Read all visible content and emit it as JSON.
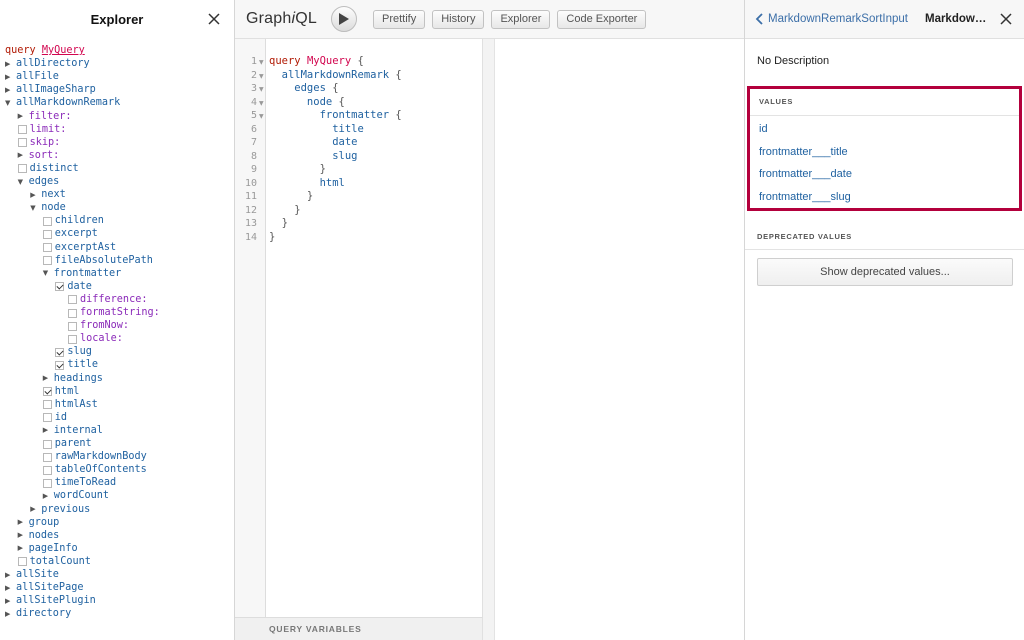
{
  "explorer": {
    "title": "Explorer",
    "tree": [
      {
        "d": 0,
        "t": "none",
        "label": "query",
        "label2": "MyQuery",
        "c": "kw"
      },
      {
        "d": 0,
        "t": "right",
        "label": "allDirectory",
        "c": "field"
      },
      {
        "d": 0,
        "t": "right",
        "label": "allFile",
        "c": "field"
      },
      {
        "d": 0,
        "t": "right",
        "label": "allImageSharp",
        "c": "field"
      },
      {
        "d": 0,
        "t": "down",
        "label": "allMarkdownRemark",
        "c": "field"
      },
      {
        "d": 1,
        "t": "right",
        "label": "filter:",
        "c": "arg"
      },
      {
        "d": 1,
        "t": "cb",
        "label": "limit:",
        "c": "arg"
      },
      {
        "d": 1,
        "t": "cb",
        "label": "skip:",
        "c": "arg"
      },
      {
        "d": 1,
        "t": "right",
        "label": "sort:",
        "c": "arg"
      },
      {
        "d": 1,
        "t": "cb",
        "label": "distinct",
        "c": "field"
      },
      {
        "d": 1,
        "t": "down",
        "label": "edges",
        "c": "field"
      },
      {
        "d": 2,
        "t": "right",
        "label": "next",
        "c": "field"
      },
      {
        "d": 2,
        "t": "down",
        "label": "node",
        "c": "field"
      },
      {
        "d": 3,
        "t": "cb",
        "label": "children",
        "c": "field"
      },
      {
        "d": 3,
        "t": "cb",
        "label": "excerpt",
        "c": "field"
      },
      {
        "d": 3,
        "t": "cb",
        "label": "excerptAst",
        "c": "field"
      },
      {
        "d": 3,
        "t": "cb",
        "label": "fileAbsolutePath",
        "c": "field"
      },
      {
        "d": 3,
        "t": "down",
        "label": "frontmatter",
        "c": "field"
      },
      {
        "d": 4,
        "t": "cbc",
        "label": "date",
        "c": "field"
      },
      {
        "d": 5,
        "t": "cb",
        "label": "difference:",
        "c": "arg"
      },
      {
        "d": 5,
        "t": "cb",
        "label": "formatString:",
        "c": "arg"
      },
      {
        "d": 5,
        "t": "cb",
        "label": "fromNow:",
        "c": "arg"
      },
      {
        "d": 5,
        "t": "cb",
        "label": "locale:",
        "c": "arg"
      },
      {
        "d": 4,
        "t": "cbc",
        "label": "slug",
        "c": "field"
      },
      {
        "d": 4,
        "t": "cbc",
        "label": "title",
        "c": "field"
      },
      {
        "d": 3,
        "t": "right",
        "label": "headings",
        "c": "field"
      },
      {
        "d": 3,
        "t": "cbc",
        "label": "html",
        "c": "field"
      },
      {
        "d": 3,
        "t": "cb",
        "label": "htmlAst",
        "c": "field"
      },
      {
        "d": 3,
        "t": "cb",
        "label": "id",
        "c": "field"
      },
      {
        "d": 3,
        "t": "right",
        "label": "internal",
        "c": "field"
      },
      {
        "d": 3,
        "t": "cb",
        "label": "parent",
        "c": "field"
      },
      {
        "d": 3,
        "t": "cb",
        "label": "rawMarkdownBody",
        "c": "field"
      },
      {
        "d": 3,
        "t": "cb",
        "label": "tableOfContents",
        "c": "field"
      },
      {
        "d": 3,
        "t": "cb",
        "label": "timeToRead",
        "c": "field"
      },
      {
        "d": 3,
        "t": "right",
        "label": "wordCount",
        "c": "field"
      },
      {
        "d": 2,
        "t": "right",
        "label": "previous",
        "c": "field"
      },
      {
        "d": 1,
        "t": "right",
        "label": "group",
        "c": "field"
      },
      {
        "d": 1,
        "t": "right",
        "label": "nodes",
        "c": "field"
      },
      {
        "d": 1,
        "t": "right",
        "label": "pageInfo",
        "c": "field"
      },
      {
        "d": 1,
        "t": "cb",
        "label": "totalCount",
        "c": "field"
      },
      {
        "d": 0,
        "t": "right",
        "label": "allSite",
        "c": "field"
      },
      {
        "d": 0,
        "t": "right",
        "label": "allSitePage",
        "c": "field"
      },
      {
        "d": 0,
        "t": "right",
        "label": "allSitePlugin",
        "c": "field"
      },
      {
        "d": 0,
        "t": "right",
        "label": "directory",
        "c": "field"
      }
    ]
  },
  "toolbar": {
    "logo_prefix": "Graph",
    "logo_i": "i",
    "logo_suffix": "QL",
    "prettify": "Prettify",
    "history": "History",
    "explorer": "Explorer",
    "code_exporter": "Code Exporter"
  },
  "editor": {
    "lines": [
      {
        "n": "1",
        "fold": true,
        "parts": [
          {
            "t": "query ",
            "c": "#b11a04"
          },
          {
            "t": "MyQuery",
            "c": "#d2054e"
          },
          {
            "t": " {",
            "c": "#555"
          }
        ]
      },
      {
        "n": "2",
        "fold": true,
        "parts": [
          {
            "t": "  allMarkdownRemark",
            "c": "#1f61a0"
          },
          {
            "t": " {",
            "c": "#555"
          }
        ]
      },
      {
        "n": "3",
        "fold": true,
        "parts": [
          {
            "t": "    edges",
            "c": "#1f61a0"
          },
          {
            "t": " {",
            "c": "#555"
          }
        ]
      },
      {
        "n": "4",
        "fold": true,
        "parts": [
          {
            "t": "      node",
            "c": "#1f61a0"
          },
          {
            "t": " {",
            "c": "#555"
          }
        ]
      },
      {
        "n": "5",
        "fold": true,
        "parts": [
          {
            "t": "        frontmatter",
            "c": "#1f61a0"
          },
          {
            "t": " {",
            "c": "#555"
          }
        ]
      },
      {
        "n": "6",
        "fold": false,
        "parts": [
          {
            "t": "          title",
            "c": "#1f61a0"
          }
        ]
      },
      {
        "n": "7",
        "fold": false,
        "parts": [
          {
            "t": "          date",
            "c": "#1f61a0"
          }
        ]
      },
      {
        "n": "8",
        "fold": false,
        "parts": [
          {
            "t": "          slug",
            "c": "#1f61a0"
          }
        ]
      },
      {
        "n": "9",
        "fold": false,
        "parts": [
          {
            "t": "        }",
            "c": "#555"
          }
        ]
      },
      {
        "n": "10",
        "fold": false,
        "parts": [
          {
            "t": "        html",
            "c": "#1f61a0"
          }
        ]
      },
      {
        "n": "11",
        "fold": false,
        "parts": [
          {
            "t": "      }",
            "c": "#555"
          }
        ]
      },
      {
        "n": "12",
        "fold": false,
        "parts": [
          {
            "t": "    }",
            "c": "#555"
          }
        ]
      },
      {
        "n": "13",
        "fold": false,
        "parts": [
          {
            "t": "  }",
            "c": "#555"
          }
        ]
      },
      {
        "n": "14",
        "fold": false,
        "parts": [
          {
            "t": "}",
            "c": "#555"
          }
        ]
      }
    ],
    "query_variables_label": "QUERY VARIABLES"
  },
  "docs": {
    "back_label": "MarkdownRemarkSortInput",
    "title": "Markdow…",
    "description": "No Description",
    "values_title": "VALUES",
    "values": [
      "id",
      "frontmatter___title",
      "frontmatter___date",
      "frontmatter___slug"
    ],
    "deprecated_title": "DEPRECATED VALUES",
    "show_deprecated_label": "Show deprecated values..."
  },
  "colors": {
    "highlight_box": "#b3003c",
    "field": "#1f61a0",
    "argument": "#8b2bb9",
    "keyword": "#b11a04",
    "definition": "#d2054e"
  }
}
